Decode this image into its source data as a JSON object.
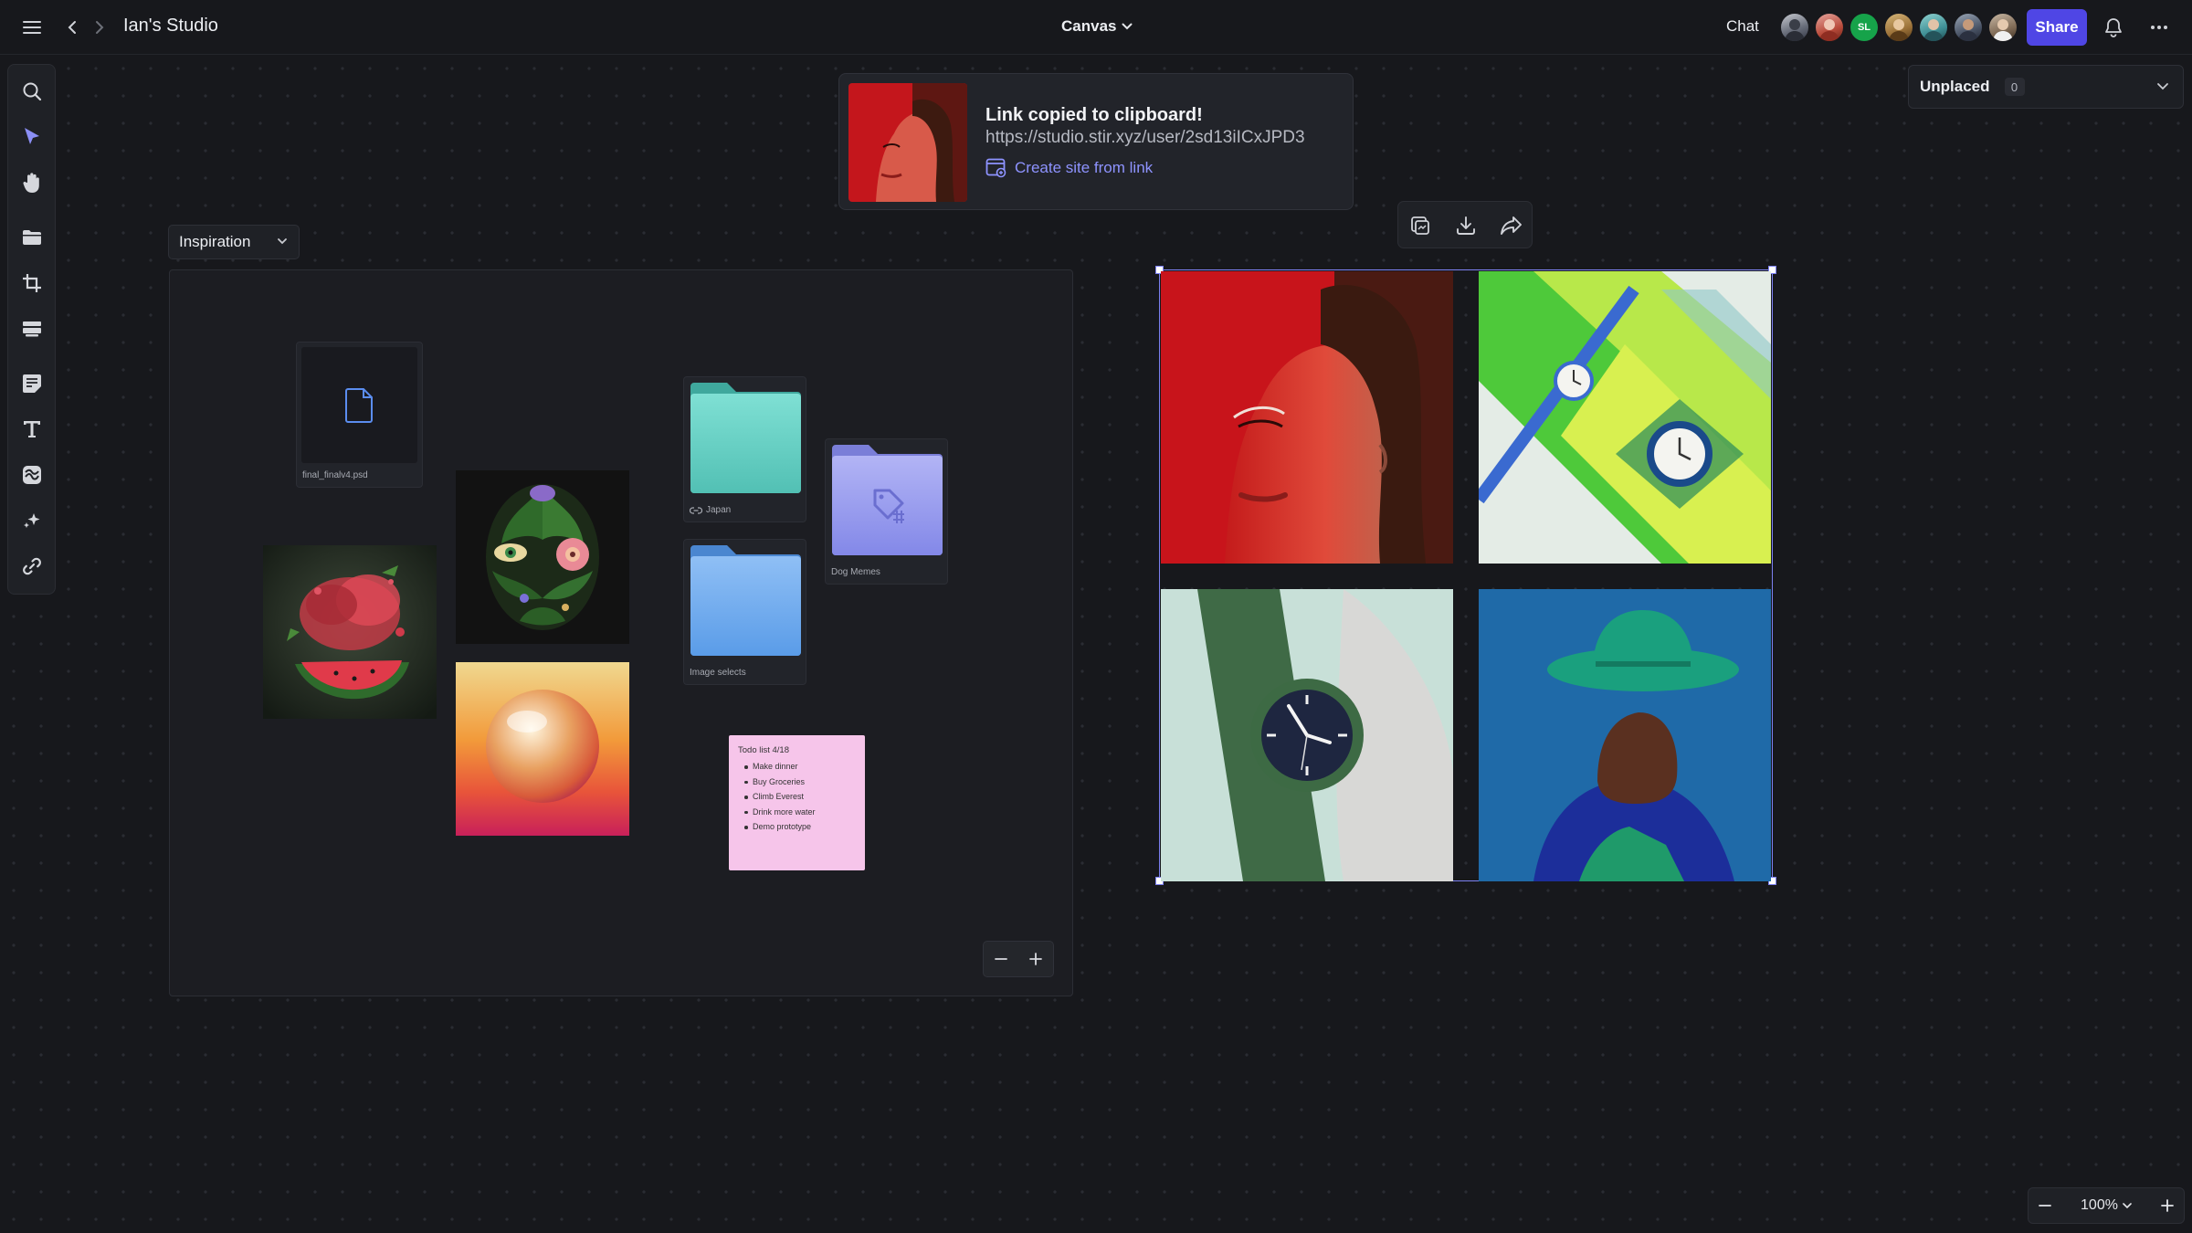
{
  "header": {
    "menu_icon": "hamburger-icon",
    "studio_title": "Ian's Studio",
    "canvas_label": "Canvas",
    "chat_label": "Chat",
    "avatar_initials": "SL",
    "share_label": "Share"
  },
  "toast": {
    "title": "Link copied to clipboard!",
    "url": "https://studio.stir.xyz/user/2sd13iICxJPD3",
    "action_label": "Create site from link"
  },
  "unplaced": {
    "label": "Unplaced",
    "count": "0"
  },
  "board": {
    "title": "Inspiration",
    "file_name": "final_finalv4.psd",
    "folder_japan": "Japan",
    "folder_image_selects": "Image selects",
    "folder_dog_memes": "Dog Memes",
    "todo": {
      "title": "Todo list 4/18",
      "items": [
        "Make dinner",
        "Buy Groceries",
        "Climb Everest",
        "Drink more water",
        "Demo prototype"
      ]
    }
  },
  "zoom": {
    "level": "100%"
  },
  "colors": {
    "accent": "#4f46e5",
    "selection": "#7c80f0",
    "background": "#17181c",
    "link": "#8e93ff"
  }
}
